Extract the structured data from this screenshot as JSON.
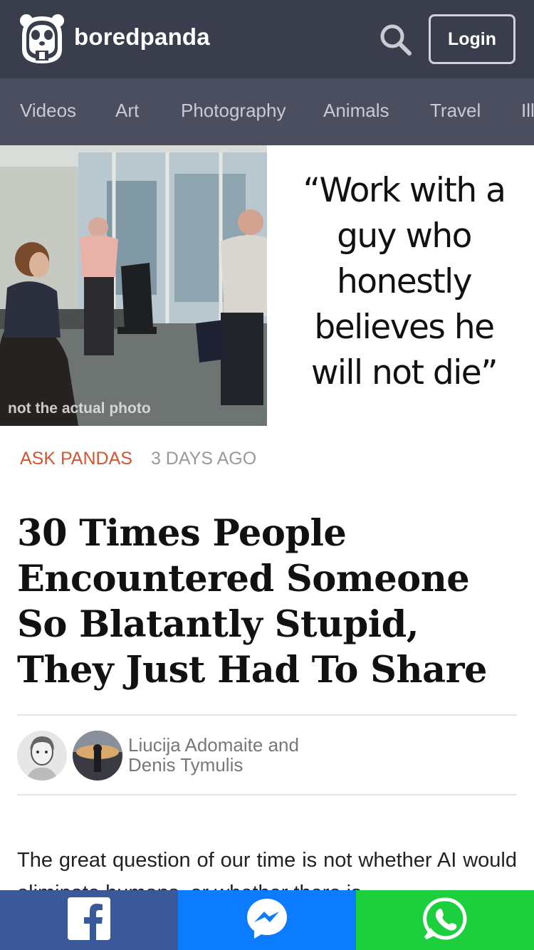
{
  "header": {
    "brand": "boredpanda",
    "login_label": "Login",
    "logo_icon": "panda-logo-icon",
    "search_icon": "search-icon",
    "bg_color": "#3a3d4b"
  },
  "categories": [
    "Videos",
    "Art",
    "Photography",
    "Animals",
    "Travel",
    "Ill"
  ],
  "hero": {
    "photo_caption": "not the actual photo",
    "quote": "“Work with a guy who honestly believes he will not die”"
  },
  "article": {
    "category": "ASK PANDAS",
    "date": "3 DAYS AGO",
    "title": "30 Times People Encountered Someone So Blatantly Stupid, They Just Had To Share",
    "author_1": "Liucija Adomaite",
    "and": "and",
    "author_2": "Denis Tymulis",
    "intro": "The great question of our time is not whether AI would eliminate humans, or whether there is"
  },
  "share": {
    "facebook_icon": "facebook-icon",
    "messenger_icon": "messenger-icon",
    "whatsapp_icon": "whatsapp-icon",
    "colors": {
      "facebook": "#3b5998",
      "messenger": "#0b7cff",
      "whatsapp": "#1ccf3d"
    }
  },
  "accent_color": "#d4552f"
}
